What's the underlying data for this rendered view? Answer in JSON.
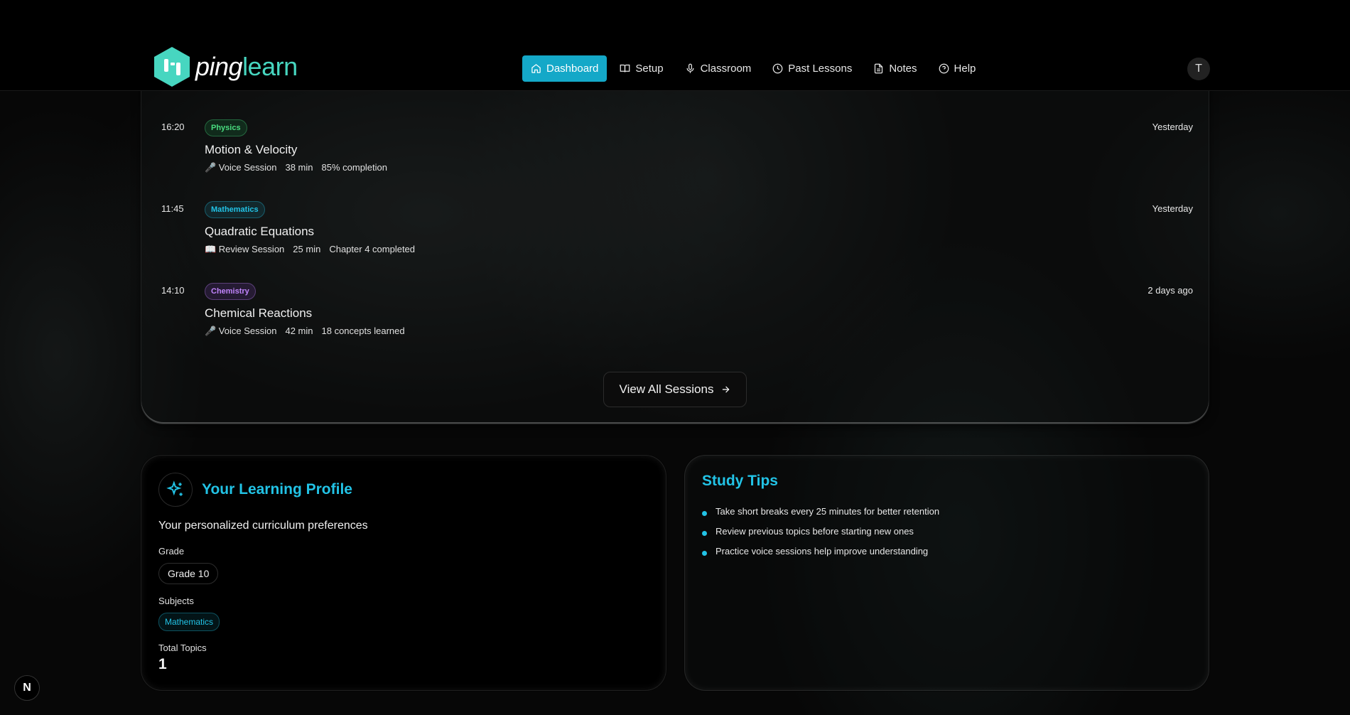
{
  "brand": {
    "name_part1": "ping",
    "name_part2": "learn"
  },
  "nav": {
    "items": [
      {
        "label": "Dashboard",
        "icon": "home-icon",
        "active": true
      },
      {
        "label": "Setup",
        "icon": "book-icon"
      },
      {
        "label": "Classroom",
        "icon": "mic-icon"
      },
      {
        "label": "Past Lessons",
        "icon": "clock-icon"
      },
      {
        "label": "Notes",
        "icon": "file-icon"
      },
      {
        "label": "Help",
        "icon": "help-circle-icon"
      }
    ]
  },
  "user": {
    "avatar_initial": "T"
  },
  "sessions": [
    {
      "time": "16:20",
      "subject": "Physics",
      "title": "Motion & Velocity",
      "type": "🎤 Voice Session",
      "duration": "38 min",
      "detail": "85% completion",
      "when": "Yesterday"
    },
    {
      "time": "11:45",
      "subject": "Mathematics",
      "title": "Quadratic Equations",
      "type": "📖 Review Session",
      "duration": "25 min",
      "detail": "Chapter 4 completed",
      "when": "Yesterday"
    },
    {
      "time": "14:10",
      "subject": "Chemistry",
      "title": "Chemical Reactions",
      "type": "🎤 Voice Session",
      "duration": "42 min",
      "detail": "18 concepts learned",
      "when": "2 days ago"
    }
  ],
  "view_all_label": "View All Sessions",
  "profile": {
    "title": "Your Learning Profile",
    "subtitle": "Your personalized curriculum preferences",
    "grade_label": "Grade",
    "grade_value": "Grade 10",
    "subjects_label": "Subjects",
    "subjects": [
      "Mathematics"
    ],
    "total_topics_label": "Total Topics",
    "total_topics_value": "1"
  },
  "tips": {
    "title": "Study Tips",
    "items": [
      "Take short breaks every 25 minutes for better retention",
      "Review previous topics before starting new ones",
      "Practice voice sessions help improve understanding"
    ]
  },
  "dev_badge": "N",
  "colors": {
    "accent": "#22c3e6",
    "brand": "#47d6c0",
    "physics": "#4ade80",
    "chemistry": "#c084fc"
  }
}
